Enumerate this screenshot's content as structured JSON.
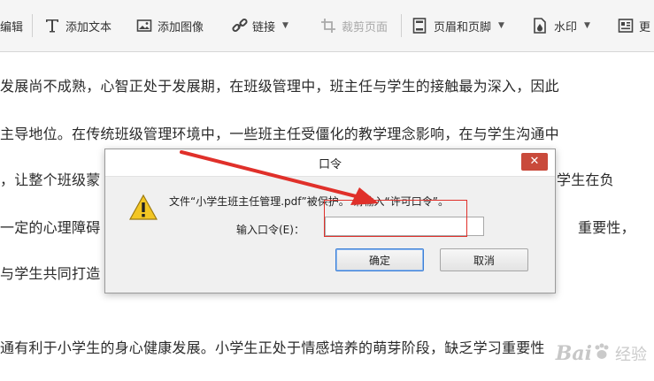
{
  "toolbar": {
    "items": [
      {
        "label": "编辑",
        "icon": "edit-icon",
        "disabled": false
      },
      {
        "label": "添加文本",
        "icon": "text-icon",
        "disabled": false
      },
      {
        "label": "添加图像",
        "icon": "image-icon",
        "disabled": false
      },
      {
        "label": "链接",
        "icon": "link-icon",
        "disabled": false,
        "dropdown": true
      },
      {
        "label": "裁剪页面",
        "icon": "crop-icon",
        "disabled": true
      },
      {
        "label": "页眉和页脚",
        "icon": "header-footer-icon",
        "disabled": false,
        "dropdown": true
      },
      {
        "label": "水印",
        "icon": "watermark-icon",
        "disabled": false,
        "dropdown": true
      },
      {
        "label": "更",
        "icon": "background-icon",
        "disabled": false
      }
    ]
  },
  "document": {
    "lines": [
      "发展尚不成熟，心智正处于发展期，在班级管理中，班主任与学生的接触最为深入，因此",
      "主导地位。在传统班级管理环境中，一些班主任受僵化的教学理念影响，在与学生沟通中",
      "，让整个班级蒙",
      "学生在负",
      "一定的心理障碍",
      "重要性，",
      "与学生共同打造",
      "通有利于小学生的身心健康发展。小学生正处于情感培养的萌芽阶段，缺乏学习重要性"
    ]
  },
  "dialog": {
    "title": "口令",
    "close_label": "✕",
    "message": "文件“小学生班主任管理.pdf”被保护。 请输入“许可口令”。",
    "password_label": "输入口令(E)：",
    "password_value": "",
    "ok_label": "确定",
    "cancel_label": "取消"
  },
  "watermark": {
    "logo": "Bai",
    "text": "经验"
  },
  "colors": {
    "annotation_red": "#e0302a",
    "close_button": "#c94a3b",
    "warning_yellow": "#f3c623"
  }
}
